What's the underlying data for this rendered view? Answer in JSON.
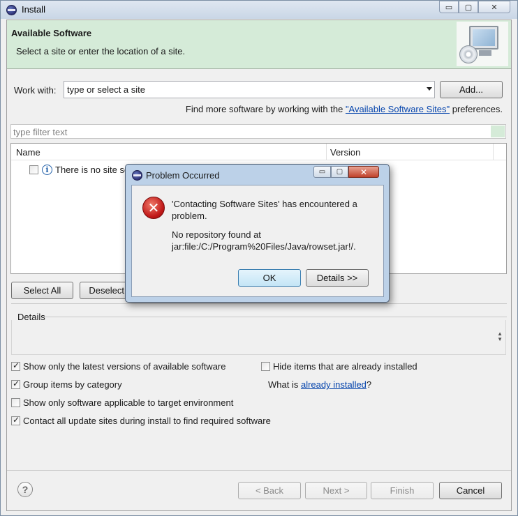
{
  "window": {
    "title": "Install",
    "minimize_glyph": "▭",
    "maximize_glyph": "▢",
    "close_glyph": "✕"
  },
  "banner": {
    "title": "Available Software",
    "description": "Select a site or enter the location of a site."
  },
  "work_with": {
    "label": "Work with:",
    "value": "type or select a site",
    "add_button": "Add..."
  },
  "find_more": {
    "prefix": "Find more software by working with the ",
    "link": "\"Available Software Sites\"",
    "suffix": " preferences."
  },
  "filter": {
    "placeholder": "type filter text"
  },
  "tree": {
    "columns": [
      "Name",
      "Version"
    ],
    "rows": [
      {
        "text": "There is no site se",
        "checked": false,
        "icon": "info-icon"
      }
    ]
  },
  "selection_buttons": {
    "select_all": "Select All",
    "deselect_all": "Deselect A"
  },
  "details": {
    "label": "Details"
  },
  "options": {
    "latest_versions": {
      "label": "Show only the latest versions of available software",
      "checked": true
    },
    "hide_installed": {
      "label": "Hide items that are already installed",
      "checked": false
    },
    "group_by_category": {
      "label": "Group items by category",
      "checked": true
    },
    "what_is_prefix": "What is ",
    "what_is_link": "already installed",
    "what_is_suffix": "?",
    "target_env": {
      "label": "Show only software applicable to target environment",
      "checked": false
    },
    "contact_sites": {
      "label": "Contact all update sites during install to find required software",
      "checked": true
    }
  },
  "footer": {
    "help_glyph": "?",
    "back": "< Back",
    "next": "Next >",
    "finish": "Finish",
    "cancel": "Cancel"
  },
  "dialog": {
    "title": "Problem Occurred",
    "message": "'Contacting Software Sites' has encountered a problem.",
    "detail_line1": "No repository found at",
    "detail_line2": "jar:file:/C:/Program%20Files/Java/rowset.jar!/.",
    "ok": "OK",
    "details_button": "Details >>",
    "error_glyph": "✕",
    "min_glyph": "▭",
    "max_glyph": "▢",
    "close_glyph": "✕"
  },
  "colors": {
    "banner_bg": "#d5ebd8",
    "link": "#0645ad",
    "error": "#c01818"
  }
}
